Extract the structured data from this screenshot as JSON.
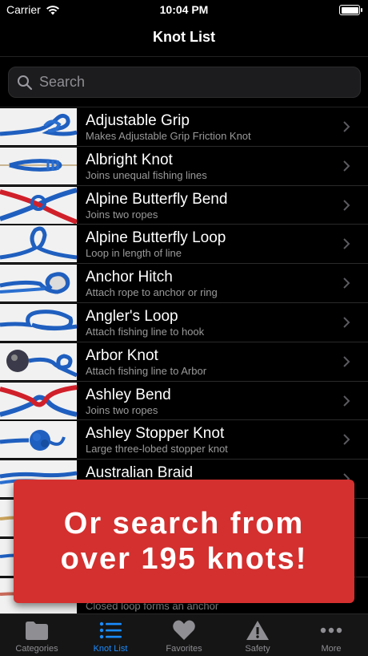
{
  "status_bar": {
    "carrier": "Carrier",
    "time": "10:04 PM"
  },
  "nav": {
    "title": "Knot List"
  },
  "search": {
    "placeholder": "Search"
  },
  "knots": [
    {
      "name": "Adjustable Grip",
      "description": "Makes Adjustable Grip Friction Knot"
    },
    {
      "name": "Albright Knot",
      "description": "Joins unequal fishing lines"
    },
    {
      "name": "Alpine Butterfly Bend",
      "description": "Joins two ropes"
    },
    {
      "name": "Alpine Butterfly Loop",
      "description": "Loop in length of line"
    },
    {
      "name": "Anchor Hitch",
      "description": "Attach rope to anchor or ring"
    },
    {
      "name": "Angler's Loop",
      "description": "Attach fishing line to hook"
    },
    {
      "name": "Arbor Knot",
      "description": "Attach fishing line to Arbor"
    },
    {
      "name": "Ashley Bend",
      "description": "Joins two ropes"
    },
    {
      "name": "Ashley Stopper Knot",
      "description": "Large three-lobed stopper knot"
    },
    {
      "name": "Australian Braid",
      "description": ""
    },
    {
      "name": "",
      "description": ""
    },
    {
      "name": "",
      "description": ""
    },
    {
      "name": "",
      "description": "Closed loop forms an anchor"
    }
  ],
  "promo": {
    "line1": "Or search from",
    "line2": "over 195 knots!"
  },
  "tabs": [
    {
      "label": "Categories",
      "icon": "folder-icon"
    },
    {
      "label": "Knot List",
      "icon": "list-icon"
    },
    {
      "label": "Favorites",
      "icon": "heart-icon"
    },
    {
      "label": "Safety",
      "icon": "warning-icon"
    },
    {
      "label": "More",
      "icon": "ellipsis-icon"
    }
  ],
  "colors": {
    "accent": "#1a8cff",
    "promo_background": "#d3302f",
    "rope_blue": "#1f5fbf",
    "rope_red": "#d0202a"
  }
}
